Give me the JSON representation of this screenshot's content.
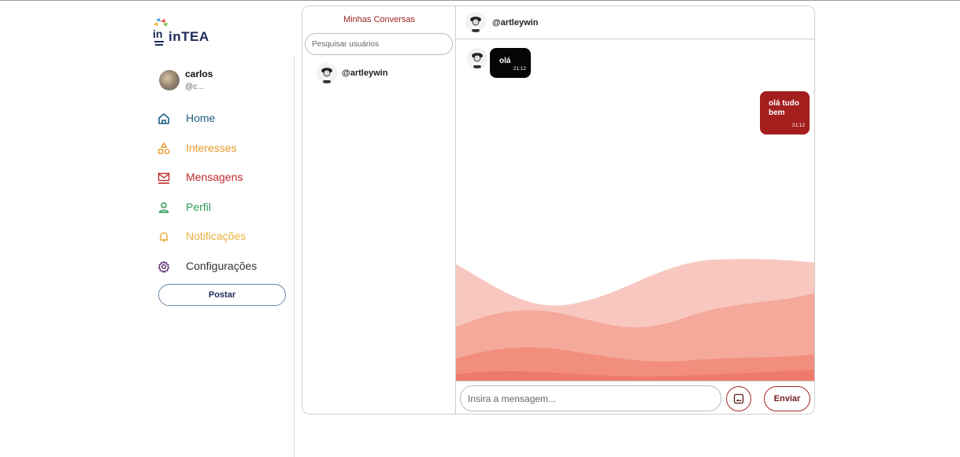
{
  "app": {
    "logo_text": "inTEA",
    "accent_color": "#a51e1e"
  },
  "user": {
    "name": "carlos",
    "handle": "@c..."
  },
  "nav": {
    "items": [
      {
        "label": "Home",
        "icon": "home-icon",
        "color": "#1e5f80"
      },
      {
        "label": "Interesses",
        "icon": "shapes-icon",
        "color": "#e79a2e"
      },
      {
        "label": "Mensagens",
        "icon": "mail-icon",
        "color": "#c0282b"
      },
      {
        "label": "Perfil",
        "icon": "user-icon",
        "color": "#2f9a57"
      },
      {
        "label": "Notificações",
        "icon": "bell-icon",
        "color": "#e9b03a"
      },
      {
        "label": "Configurações",
        "icon": "gear-icon",
        "color": "#5d2c6f"
      }
    ],
    "post_label": "Postar"
  },
  "conversations": {
    "title": "Minhas Conversas",
    "search_placeholder": "Pesquisar usuários",
    "items": [
      {
        "username": "@artleywin"
      }
    ]
  },
  "chat": {
    "header_username": "@artleywin",
    "messages": [
      {
        "direction": "in",
        "text": "olá",
        "time": "21:12"
      },
      {
        "direction": "out",
        "text_line1": "olá tudo",
        "text_line2": "bem",
        "time": "21:12"
      }
    ],
    "input_placeholder": "Insira a mensagem...",
    "send_label": "Enviar"
  }
}
